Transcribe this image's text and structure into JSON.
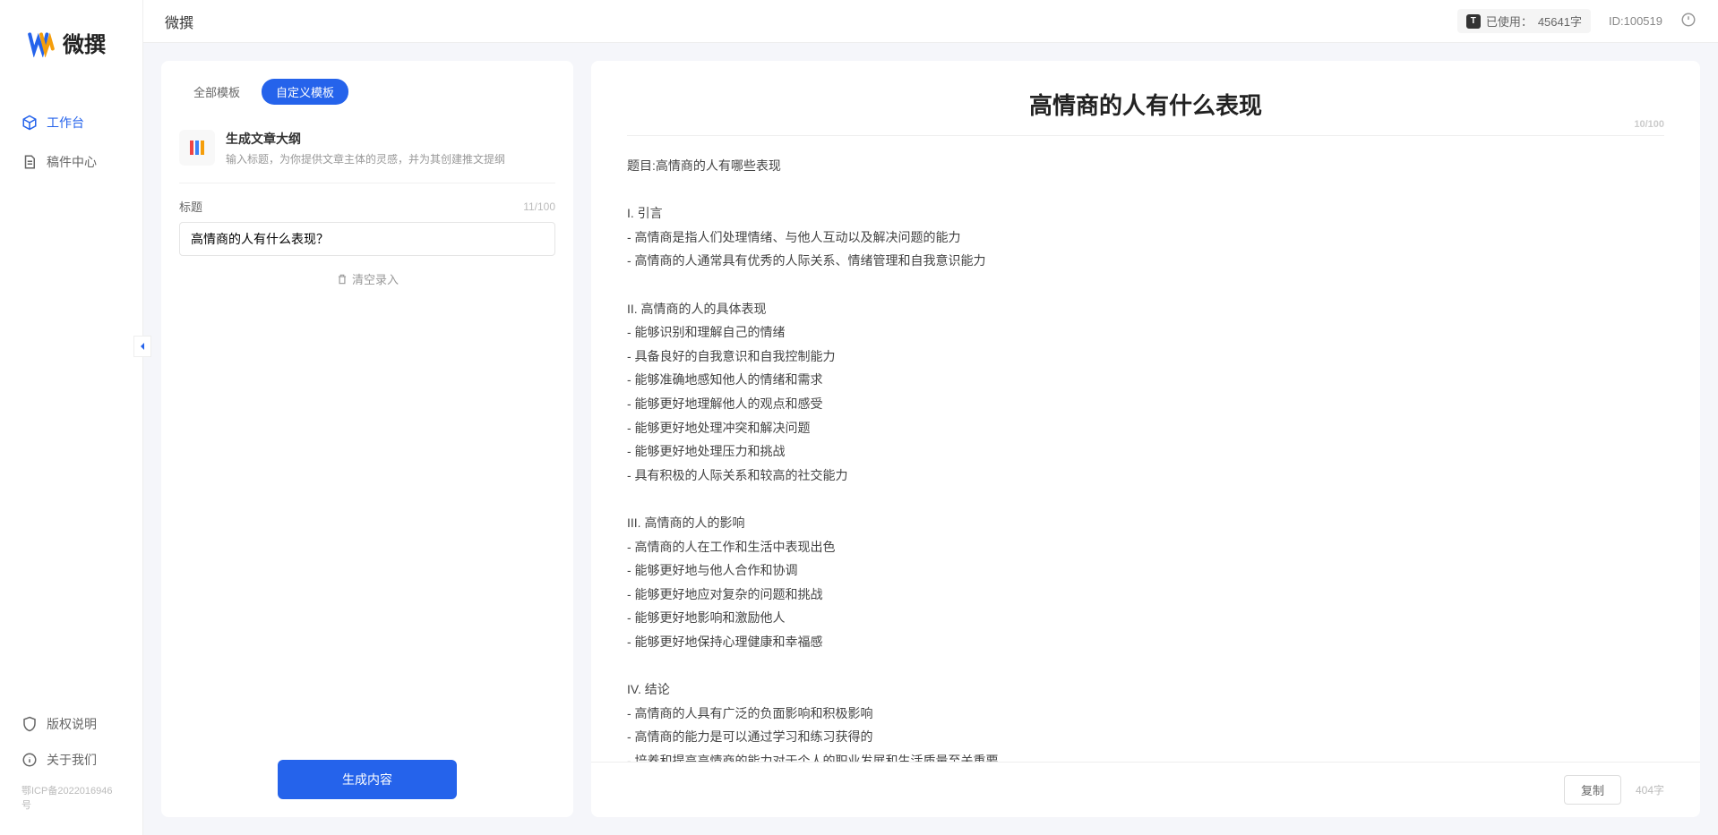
{
  "brand": {
    "name": "微撰"
  },
  "header": {
    "title": "微撰",
    "usage_label": "已使用：",
    "usage_value": "45641字",
    "user_id_label": "ID:",
    "user_id_value": "100519"
  },
  "sidebar": {
    "nav": [
      {
        "label": "工作台",
        "icon": "cube",
        "active": true
      },
      {
        "label": "稿件中心",
        "icon": "doc",
        "active": false
      }
    ],
    "footer": [
      {
        "label": "版权说明",
        "icon": "shield"
      },
      {
        "label": "关于我们",
        "icon": "info"
      }
    ],
    "icp": "鄂ICP备2022016946号"
  },
  "left": {
    "tabs": [
      {
        "label": "全部模板",
        "active": false
      },
      {
        "label": "自定义模板",
        "active": true
      }
    ],
    "template": {
      "title": "生成文章大纲",
      "desc": "输入标题，为你提供文章主体的灵感，并为其创建推文提纲"
    },
    "title_field": {
      "label": "标题",
      "counter": "11/100",
      "value": "高情商的人有什么表现？"
    },
    "clear_label": "清空录入",
    "generate_label": "生成内容"
  },
  "right": {
    "title": "高情商的人有什么表现",
    "title_counter": "10/100",
    "content": "题目:高情商的人有哪些表现\n\nI. 引言\n- 高情商是指人们处理情绪、与他人互动以及解决问题的能力\n- 高情商的人通常具有优秀的人际关系、情绪管理和自我意识能力\n\nII. 高情商的人的具体表现\n- 能够识别和理解自己的情绪\n- 具备良好的自我意识和自我控制能力\n- 能够准确地感知他人的情绪和需求\n- 能够更好地理解他人的观点和感受\n- 能够更好地处理冲突和解决问题\n- 能够更好地处理压力和挑战\n- 具有积极的人际关系和较高的社交能力\n\nIII. 高情商的人的影响\n- 高情商的人在工作和生活中表现出色\n- 能够更好地与他人合作和协调\n- 能够更好地应对复杂的问题和挑战\n- 能够更好地影响和激励他人\n- 能够更好地保持心理健康和幸福感\n\nIV. 结论\n- 高情商的人具有广泛的负面影响和积极影响\n- 高情商的能力是可以通过学习和练习获得的\n- 培养和提高高情商的能力对于个人的职业发展和生活质量至关重要。",
    "copy_label": "复制",
    "word_count": "404字"
  }
}
